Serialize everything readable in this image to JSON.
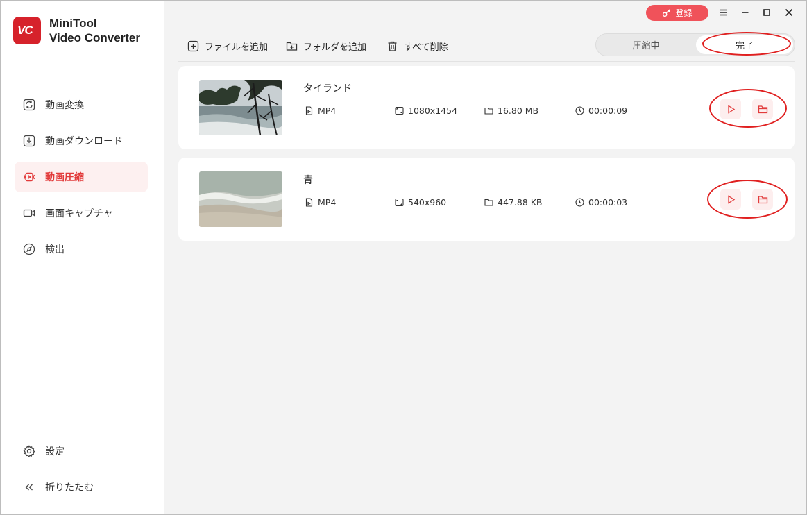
{
  "app": {
    "name_line1": "MiniTool",
    "name_line2": "Video Converter",
    "logo_text": "VC",
    "brand_color": "#d6222b",
    "accent_color": "#e23b3b"
  },
  "titlebar": {
    "login_label": "登録",
    "login_icon": "key-icon",
    "menu_icon": "hamburger-icon",
    "minimize_icon": "minimize-icon",
    "maximize_icon": "maximize-icon",
    "close_icon": "close-icon"
  },
  "sidebar": {
    "items": [
      {
        "label": "動画変換",
        "icon": "convert-icon",
        "active": false
      },
      {
        "label": "動画ダウンロード",
        "icon": "download-icon",
        "active": false
      },
      {
        "label": "動画圧縮",
        "icon": "compress-icon",
        "active": true
      },
      {
        "label": "画面キャプチャ",
        "icon": "camera-icon",
        "active": false
      },
      {
        "label": "検出",
        "icon": "compass-icon",
        "active": false
      }
    ],
    "settings_label": "設定",
    "collapse_label": "折りたたむ"
  },
  "toolbar": {
    "add_file": "ファイルを追加",
    "add_folder": "フォルダを追加",
    "delete_all": "すべて削除"
  },
  "tabs": {
    "compressing": "圧縮中",
    "done": "完了",
    "active": "done"
  },
  "files": [
    {
      "name": "タイランド",
      "format": "MP4",
      "resolution": "1080x1454",
      "size": "16.80 MB",
      "duration": "00:00:09"
    },
    {
      "name": "青",
      "format": "MP4",
      "resolution": "540x960",
      "size": "447.88 KB",
      "duration": "00:00:03"
    }
  ]
}
